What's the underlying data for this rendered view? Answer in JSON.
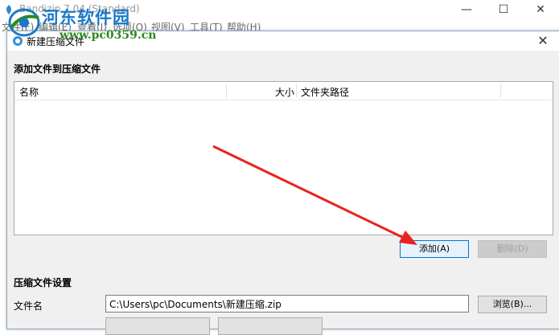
{
  "background_window": {
    "title": "Bandizip 7.04 (Standard)",
    "menu": [
      "文件(F)",
      "编辑(E)",
      "查看(I)",
      "选项(O)",
      "视图(V)",
      "工具(T)",
      "帮助(H)"
    ],
    "controls": {
      "minimize": "—",
      "maximize": "☐",
      "close": "✕"
    }
  },
  "watermark": {
    "site_name": "河东软件园",
    "url": "www.pc0359.cn"
  },
  "dialog": {
    "title": "新建压缩文件",
    "close": "✕",
    "files_section": {
      "heading": "添加文件到压缩文件",
      "columns": [
        "名称",
        "大小",
        "文件夹路径"
      ],
      "add_button": "添加(A)",
      "delete_button": "删除(D)"
    },
    "settings_section": {
      "heading": "压缩文件设置",
      "filename_label": "文件名",
      "filename_value": "C:\\Users\\pc\\Documents\\新建压缩.zip",
      "browse_button": "浏览(B)..."
    }
  },
  "colors": {
    "accent": "#0078d7",
    "arrow": "#e8241c",
    "watermark_blue": "#1978c8",
    "watermark_green": "#2a8a1e"
  }
}
